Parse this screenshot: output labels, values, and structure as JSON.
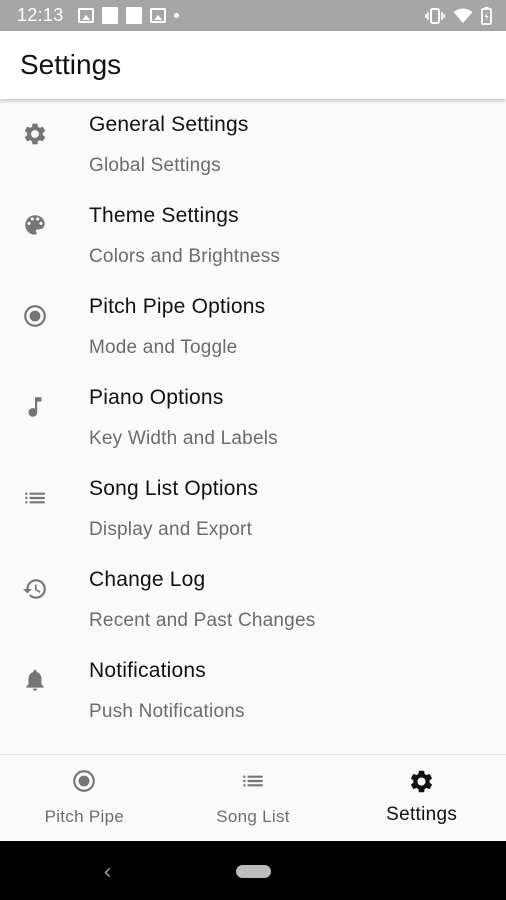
{
  "status_bar": {
    "time": "12:13",
    "left_icons": [
      "image-icon",
      "square-icon",
      "square-icon",
      "gallery-icon",
      "dot-icon"
    ],
    "right_icons": [
      "vibrate-icon",
      "wifi-icon",
      "battery-icon"
    ]
  },
  "app_bar": {
    "title": "Settings"
  },
  "settings": [
    {
      "icon": "gear-icon",
      "title": "General Settings",
      "subtitle": "Global Settings"
    },
    {
      "icon": "palette-icon",
      "title": "Theme Settings",
      "subtitle": "Colors and Brightness"
    },
    {
      "icon": "radio-button-icon",
      "title": "Pitch Pipe Options",
      "subtitle": "Mode and Toggle"
    },
    {
      "icon": "music-note-icon",
      "title": "Piano Options",
      "subtitle": "Key Width and Labels"
    },
    {
      "icon": "list-icon",
      "title": "Song List Options",
      "subtitle": "Display and Export"
    },
    {
      "icon": "history-icon",
      "title": "Change Log",
      "subtitle": "Recent and Past Changes"
    },
    {
      "icon": "bell-icon",
      "title": "Notifications",
      "subtitle": "Push Notifications"
    }
  ],
  "bottom_nav": {
    "tabs": [
      {
        "icon": "radio-button-icon",
        "label": "Pitch Pipe"
      },
      {
        "icon": "list-icon",
        "label": "Song List"
      },
      {
        "icon": "gear-icon",
        "label": "Settings",
        "active": true
      }
    ]
  },
  "system_nav": {
    "icons": [
      "back-icon",
      "home-icon"
    ]
  },
  "colors": {
    "status_bar": "#a6a6a6",
    "app_bar": "#ffffff",
    "background": "#fafafa",
    "title_text": "#111111",
    "subtitle_text": "#6b6b6b",
    "icon": "#757575",
    "active_tab": "#111111",
    "system_nav": "#000000"
  }
}
